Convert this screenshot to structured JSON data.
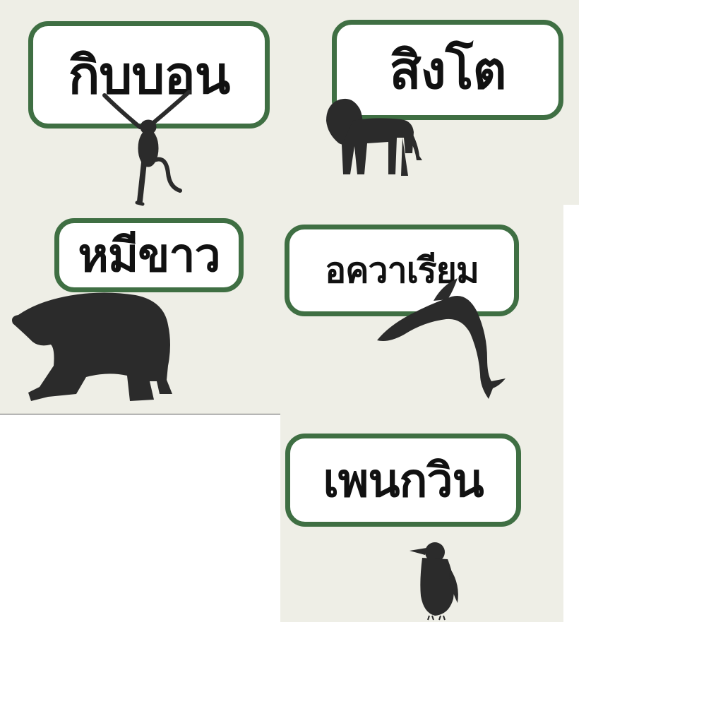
{
  "colors": {
    "panel_bg": "#eeeee6",
    "sign_border": "#3f6f43",
    "sign_bg": "#ffffff",
    "silhouette": "#2b2b2b",
    "text": "#111111"
  },
  "signs": [
    {
      "label": "กิบบอน",
      "icon": "gibbon-icon"
    },
    {
      "label": "สิงโต",
      "icon": "lion-icon"
    },
    {
      "label": "หมีขาว",
      "icon": "polar-bear-icon"
    },
    {
      "label": "อควาเรียม",
      "icon": "dolphin-icon"
    },
    {
      "label": "เพนกวิน",
      "icon": "penguin-icon"
    }
  ]
}
